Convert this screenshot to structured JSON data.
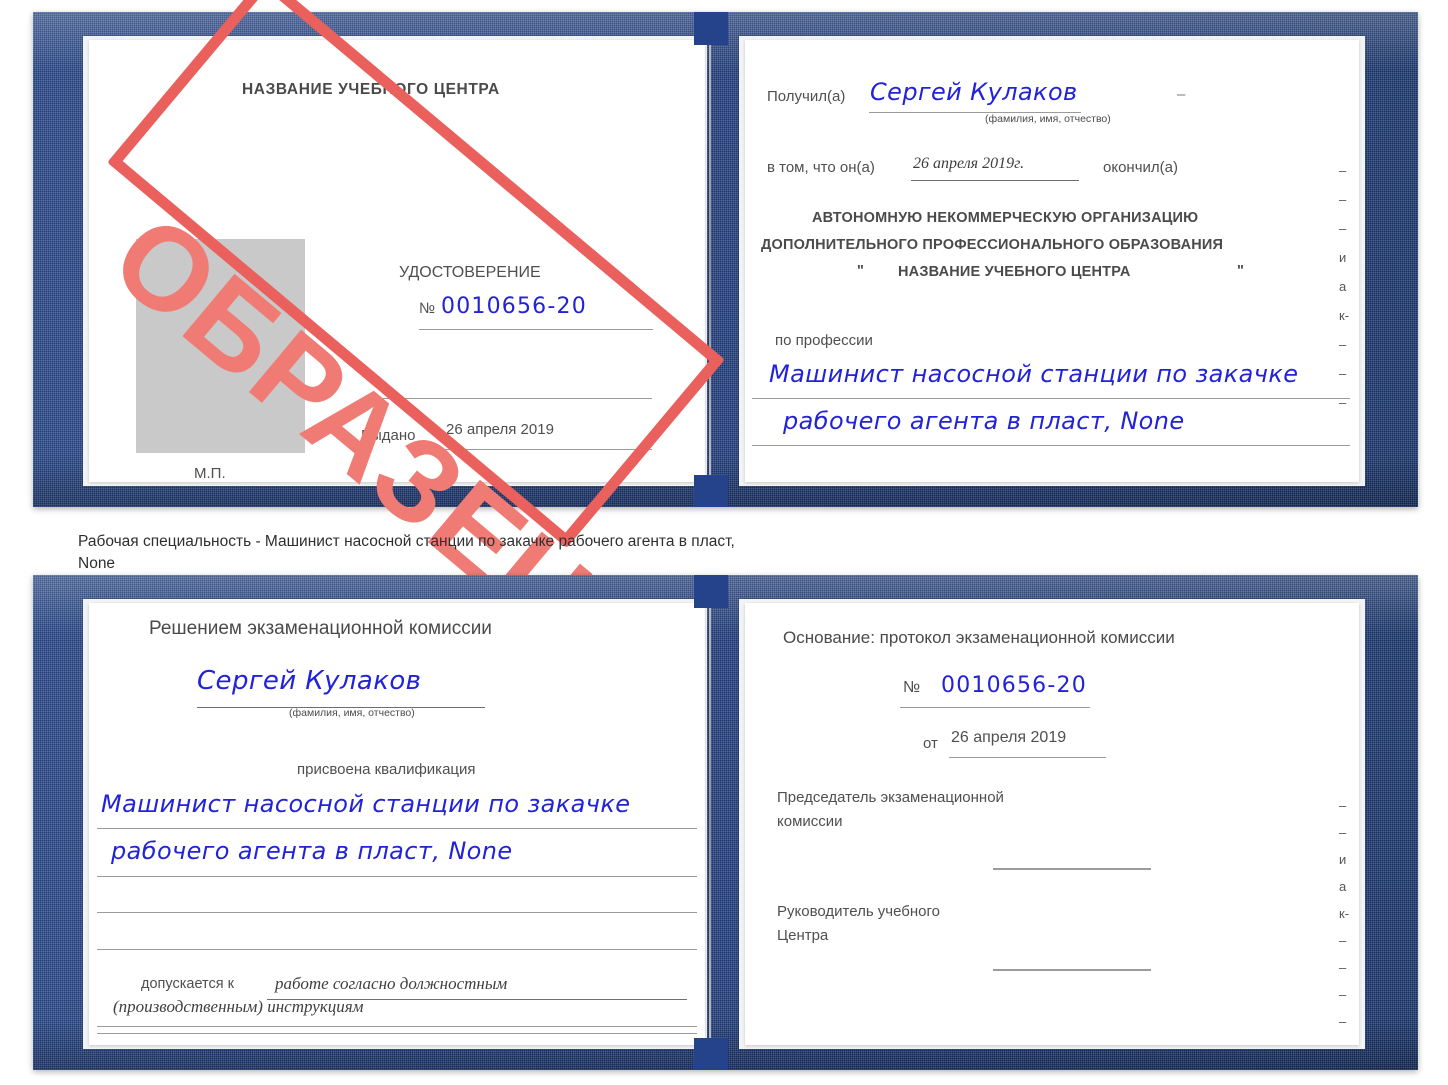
{
  "document": {
    "kind": "Удостоверение",
    "stamp_text": "ОБРАЗЕЦ",
    "stamp_color": "#e9605c",
    "ink_color": "#2222d8",
    "cover_color": "#28468a"
  },
  "caption": {
    "line1": "Рабочая специальность - Машинист насосной станции по закачке рабочего агента в пласт,",
    "line2": "None"
  },
  "spread_top": {
    "left_page": {
      "center_name": "НАЗВАНИЕ УЧЕБНОГО ЦЕНТРА",
      "doc_title": "УДОСТОВЕРЕНИЕ",
      "number_label": "№",
      "number_value": "0010656-20",
      "issued_label": "Выдано",
      "issued_date": "26 апреля 2019",
      "seal_label": "М.П.",
      "photo_placeholder": "photo-placeholder"
    },
    "right_page": {
      "received_label": "Получил(а)",
      "received_name": "Сергей Кулаков",
      "fio_hint": "(фамилия, имя, отчество)",
      "that_he_label": "в том, что он(а)",
      "completion_date": "26 апреля 2019г.",
      "finished_label": "окончил(а)",
      "org_line1": "АВТОНОМНУЮ НЕКОММЕРЧЕСКУЮ ОРГАНИЗАЦИЮ",
      "org_line2": "ДОПОЛНИТЕЛЬНОГО ПРОФЕССИОНАЛЬНОГО ОБРАЗОВАНИЯ",
      "org_quote_open": "\"",
      "org_name": "НАЗВАНИЕ УЧЕБНОГО ЦЕНТРА",
      "org_quote_close": "\"",
      "profession_label": "по профессии",
      "profession_line1": "Машинист насосной станции по закачке",
      "profession_line2": "рабочего агента в пласт, None",
      "edge_fragments": [
        "–",
        "–",
        "–",
        "и",
        "а",
        "к-",
        "–",
        "–",
        "–"
      ]
    }
  },
  "spread_bottom": {
    "left_page": {
      "heading": "Решением экзаменационной комиссии",
      "name": "Сергей Кулаков",
      "fio_hint": "(фамилия, имя, отчество)",
      "qualification_label": "присвоена квалификация",
      "qualification_line1": "Машинист насосной станции по закачке",
      "qualification_line2": "рабочего агента в пласт, None",
      "admitted_label": "допускается к",
      "admitted_line1": "работе согласно должностным",
      "admitted_line2": "(производственным) инструкциям"
    },
    "right_page": {
      "basis_label": "Основание: протокол экзаменационной комиссии",
      "number_label": "№",
      "number_value": "0010656-20",
      "date_label": "от",
      "date_value": "26 апреля 2019",
      "chairman_line1": "Председатель экзаменационной",
      "chairman_line2": "комиссии",
      "director_line1": "Руководитель учебного",
      "director_line2": "Центра",
      "edge_fragments": [
        "–",
        "–",
        "и",
        "а",
        "к-",
        "–",
        "–",
        "–",
        "–"
      ]
    }
  }
}
